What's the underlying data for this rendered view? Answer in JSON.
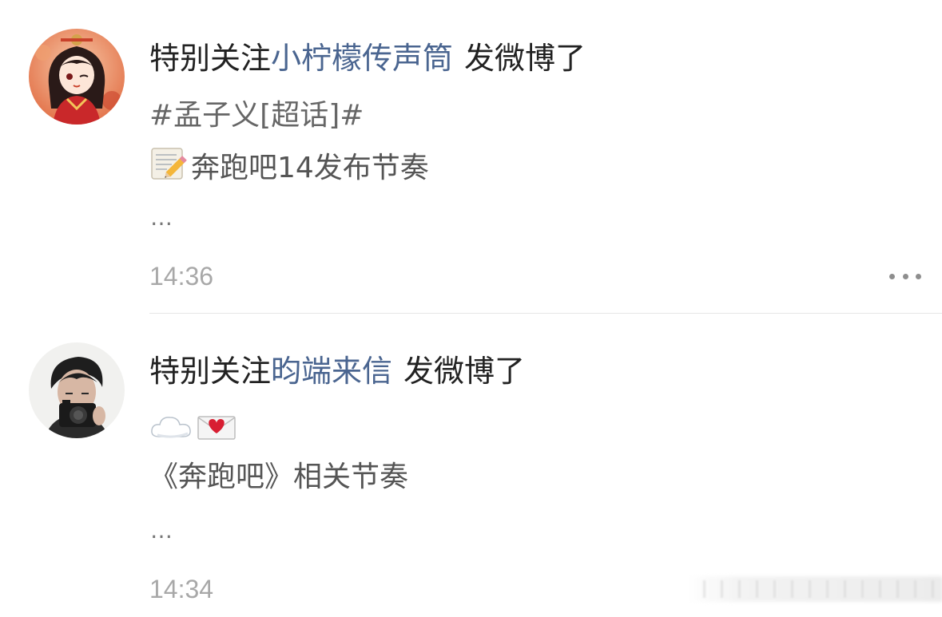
{
  "feed": [
    {
      "prefix": "特别关注",
      "author": "小柠檬传声筒",
      "suffix": "发微博了",
      "topic": "#孟子义[超话]#",
      "line_text": "奔跑吧14发布节奏",
      "ellipsis": "…",
      "time": "14:36",
      "avatar_icon": "illustrated-girl-avatar",
      "line_icon": "memo-pencil-icon"
    },
    {
      "prefix": "特别关注",
      "author": "昀端来信",
      "suffix": "发微博了",
      "emoji_icons": [
        "cloud-icon",
        "love-letter-icon"
      ],
      "line_text": "《奔跑吧》相关节奏",
      "ellipsis": "…",
      "time": "14:34",
      "avatar_icon": "photo-camera-man-avatar"
    }
  ],
  "colors": {
    "author_link": "#4a6590",
    "timestamp": "#a8a8a8",
    "divider": "#e6e6e6"
  }
}
